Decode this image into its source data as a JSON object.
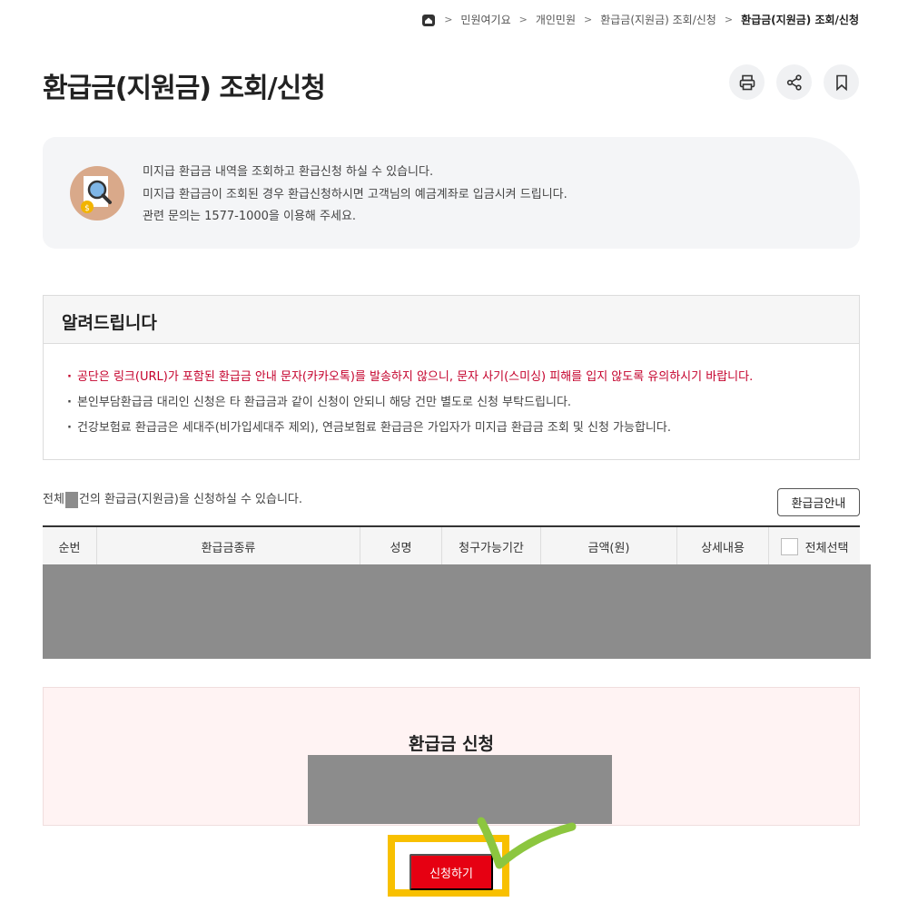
{
  "breadcrumb": {
    "items": [
      "민원여기요",
      "개인민원",
      "환급금(지원금) 조회/신청"
    ],
    "current": "환급금(지원금) 조회/신청"
  },
  "page": {
    "title": "환급금(지원금) 조회/신청"
  },
  "intro": {
    "lines": [
      "미지급 환급금 내역을 조회하고 환급신청 하실 수 있습니다.",
      "미지급 환급금이 조회된 경우 환급신청하시면 고객님의 예금계좌로 입금시켜 드립니다.",
      "관련 문의는 1577-1000을 이용해 주세요."
    ]
  },
  "notice": {
    "title": "알려드립니다",
    "items": [
      "공단은 링크(URL)가 포함된 환급금 안내 문자(카카오톡)를 발송하지 않으니, 문자 사기(스미싱) 피해를 입지 않도록 유의하시기 바랍니다.",
      "본인부담환급금 대리인 신청은 타 환급금과 같이 신청이 안되니 해당 건만 별도로 신청 부탁드립니다.",
      "건강보험료 환급금은 세대주(비가입세대주 제외), 연금보험료 환급금은 가입자가 미지급 환급금 조회 및 신청 가능합니다."
    ]
  },
  "summary": {
    "prefix": "전체",
    "suffix": "건의 환급금(지원금)을 신청하실 수 있습니다."
  },
  "buttons": {
    "guide": "환급금안내",
    "submit": "신청하기"
  },
  "table": {
    "headers": [
      "순번",
      "환급금종류",
      "성명",
      "청구가능기간",
      "금액(원)",
      "상세내용",
      "전체선택"
    ]
  },
  "apply": {
    "title": "환급금 신청"
  },
  "colors": {
    "accent_red": "#e60012",
    "warning_text": "#c4002b",
    "highlight": "#f8c000",
    "check_mark": "#8cc63f"
  }
}
